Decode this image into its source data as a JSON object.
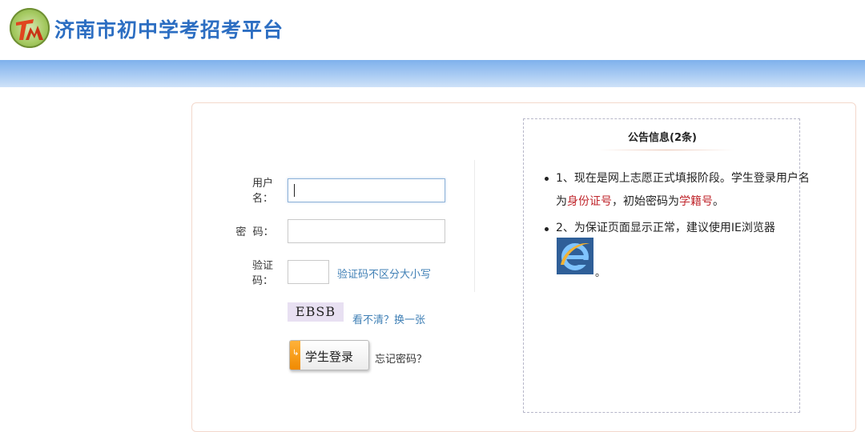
{
  "header": {
    "site_title": "济南市初中学考招考平台",
    "logo_icon": "tm-logo",
    "accent_color": "#2c6ec2"
  },
  "login": {
    "username_label_line1": "用户",
    "username_label_line2": "名：",
    "password_label": "密  码：",
    "captcha_label_line1": "验证",
    "captcha_label_line2": "码：",
    "username_value": "",
    "password_value": "",
    "captcha_value": "",
    "captcha_hint": "验证码不区分大小写",
    "captcha_image_text": "EBSB",
    "refresh_captcha": "看不清？换一张",
    "login_button": "学生登录",
    "forgot_password": "忘记密码？"
  },
  "notice": {
    "title": "公告信息(2条)",
    "item1_line1": "1、现在是网上志愿正式填报阶段。学生登录用户名",
    "item1_line2_a": "为",
    "item1_line2_b": "身份证号",
    "item1_line2_c": "，初始密码为",
    "item1_line2_d": "学籍号",
    "item1_line2_e": "。",
    "item2_line1": "2、为保证页面显示正常，建议使用IE浏览器",
    "item2_period": "。",
    "browser_icon": "ie-icon"
  }
}
